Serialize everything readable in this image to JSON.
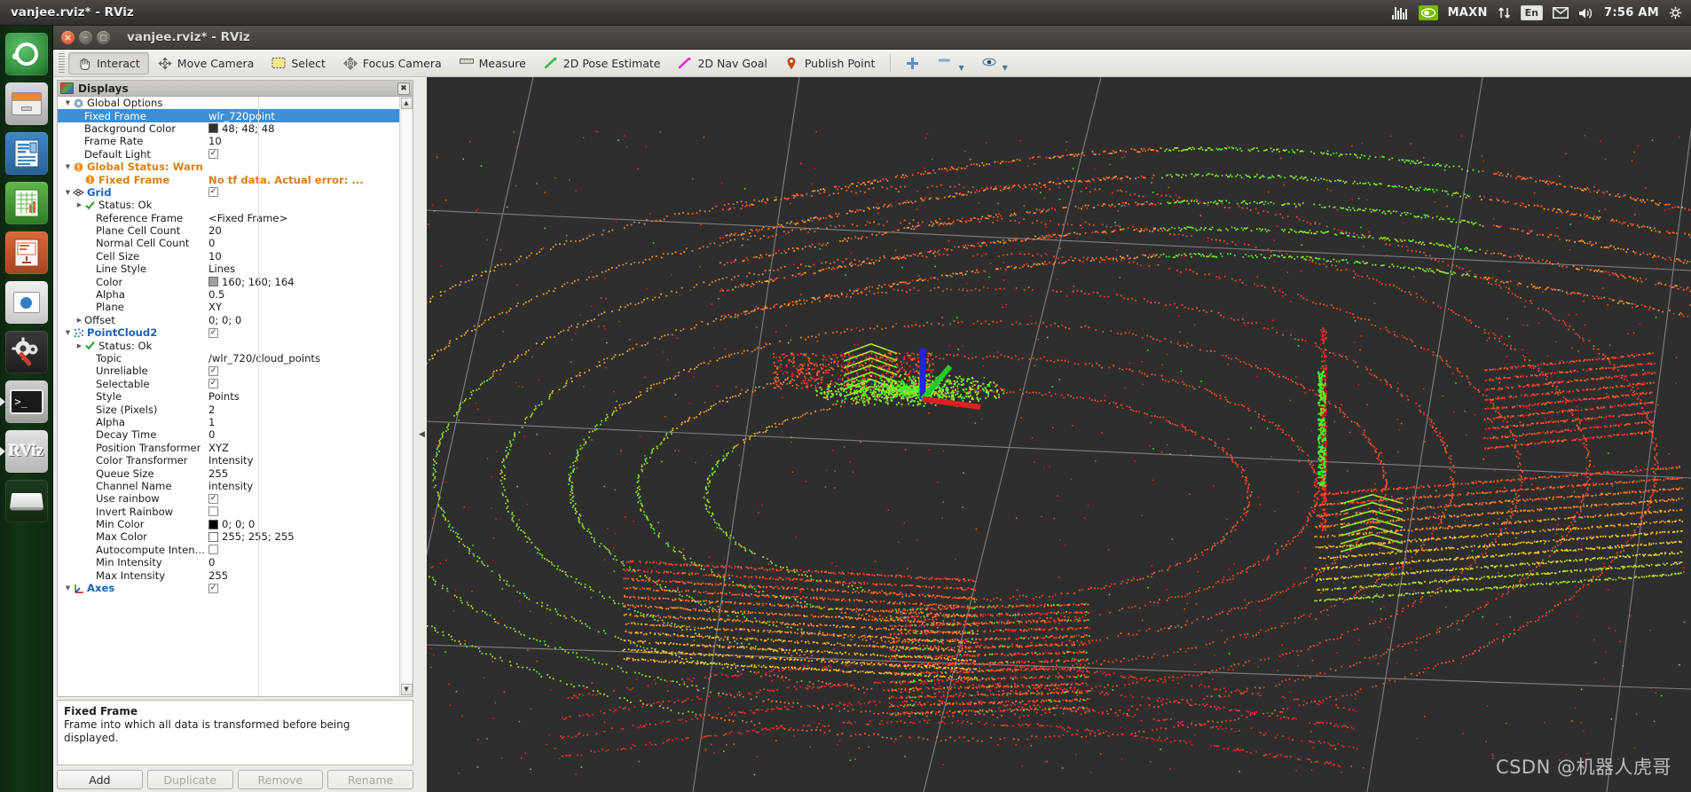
{
  "desktop": {
    "title": "vanjee.rviz* - RViz",
    "indicators": [
      {
        "name": "system-monitor-icon",
        "glyph": "ıll͡ıl",
        "type": "icon"
      },
      {
        "name": "nvidia-icon",
        "glyph": "",
        "type": "badge"
      },
      {
        "name": "maxn-indicator",
        "glyph": "MAXN",
        "type": "text"
      },
      {
        "name": "network-icon",
        "glyph": "↑↓",
        "type": "icon"
      },
      {
        "name": "keyboard-layout-indicator",
        "glyph": "En",
        "type": "kb"
      },
      {
        "name": "mail-icon",
        "glyph": "✉",
        "type": "icon"
      },
      {
        "name": "volume-icon",
        "glyph": "🔊",
        "type": "icon"
      },
      {
        "name": "clock",
        "glyph": "7:56 AM",
        "type": "text"
      },
      {
        "name": "session-menu-icon",
        "glyph": "⚙",
        "type": "icon"
      }
    ]
  },
  "launcher": {
    "items": [
      {
        "name": "ubuntu-dash-icon",
        "label": "Ubuntu Dash",
        "running": false
      },
      {
        "name": "files-icon",
        "label": "Files",
        "running": false
      },
      {
        "name": "libreoffice-writer-icon",
        "label": "LibreOffice Writer",
        "running": false
      },
      {
        "name": "libreoffice-calc-icon",
        "label": "LibreOffice Calc",
        "running": false
      },
      {
        "name": "libreoffice-impress-icon",
        "label": "LibreOffice Impress",
        "running": false
      },
      {
        "name": "ubuntu-software-icon",
        "label": "Ubuntu Software",
        "running": false
      },
      {
        "name": "system-settings-icon",
        "label": "System Settings",
        "running": false
      },
      {
        "name": "terminal-icon",
        "label": "Terminal",
        "running": true
      },
      {
        "name": "rviz-icon",
        "label": "RViz",
        "running": true
      },
      {
        "name": "disk-icon",
        "label": "Disk",
        "running": false
      }
    ]
  },
  "window": {
    "title": "vanjee.rviz* - RViz",
    "buttons": [
      "close",
      "minimize",
      "maximize"
    ]
  },
  "toolbar": {
    "items": [
      {
        "label": "Interact",
        "icon": "hand-cursor-icon",
        "active": true
      },
      {
        "label": "Move Camera",
        "icon": "move-camera-icon",
        "active": false
      },
      {
        "label": "Select",
        "icon": "select-rect-icon",
        "active": false
      },
      {
        "label": "Focus Camera",
        "icon": "focus-camera-icon",
        "active": false
      },
      {
        "label": "Measure",
        "icon": "measure-ruler-icon",
        "active": false
      },
      {
        "label": "2D Pose Estimate",
        "icon": "pose-estimate-arrow-icon",
        "active": false
      },
      {
        "label": "2D Nav Goal",
        "icon": "nav-goal-arrow-icon",
        "active": false
      },
      {
        "label": "Publish Point",
        "icon": "publish-point-pin-icon",
        "active": false
      }
    ],
    "tools": [
      {
        "name": "add-tool-button",
        "glyph": "+"
      },
      {
        "name": "remove-tool-button",
        "glyph": "–",
        "caret": true
      },
      {
        "name": "tool-properties-button",
        "glyph": "◉",
        "caret": true
      }
    ]
  },
  "displays_panel": {
    "title": "Displays",
    "close_label": "✖",
    "tree": [
      {
        "indent": 1,
        "arrow": "down",
        "icon": "gear-icon",
        "name": "Global Options",
        "value": "",
        "vtype": "none",
        "style": "plain",
        "selected": false
      },
      {
        "indent": 2,
        "arrow": "none",
        "icon": "none",
        "name": "Fixed Frame",
        "value": "wlr_720point",
        "vtype": "text",
        "style": "plain",
        "selected": true
      },
      {
        "indent": 2,
        "arrow": "none",
        "icon": "none",
        "name": "Background Color",
        "value": "48; 48; 48",
        "vtype": "color",
        "color": "#303030",
        "style": "plain",
        "selected": false
      },
      {
        "indent": 2,
        "arrow": "none",
        "icon": "none",
        "name": "Frame Rate",
        "value": "10",
        "vtype": "text",
        "style": "plain",
        "selected": false
      },
      {
        "indent": 2,
        "arrow": "none",
        "icon": "none",
        "name": "Default Light",
        "value": "",
        "vtype": "check",
        "checked": true,
        "style": "plain",
        "selected": false
      },
      {
        "indent": 1,
        "arrow": "down",
        "icon": "warning-icon",
        "name": "Global Status: Warn",
        "value": "",
        "vtype": "none",
        "style": "warn",
        "selected": false
      },
      {
        "indent": 2,
        "arrow": "none",
        "icon": "warning-icon",
        "name": "Fixed Frame",
        "value": "No tf data.  Actual error: ...",
        "vtype": "text",
        "style": "warn",
        "selected": false
      },
      {
        "indent": 1,
        "arrow": "down",
        "icon": "grid-icon",
        "name": "Grid",
        "value": "",
        "vtype": "check",
        "checked": true,
        "style": "cat",
        "selected": false
      },
      {
        "indent": 2,
        "arrow": "right",
        "icon": "ok-check-icon",
        "name": "Status: Ok",
        "value": "",
        "vtype": "none",
        "style": "plain",
        "selected": false
      },
      {
        "indent": 3,
        "arrow": "none",
        "icon": "none",
        "name": "Reference Frame",
        "value": "<Fixed Frame>",
        "vtype": "text",
        "style": "plain",
        "selected": false
      },
      {
        "indent": 3,
        "arrow": "none",
        "icon": "none",
        "name": "Plane Cell Count",
        "value": "20",
        "vtype": "text",
        "style": "plain",
        "selected": false
      },
      {
        "indent": 3,
        "arrow": "none",
        "icon": "none",
        "name": "Normal Cell Count",
        "value": "0",
        "vtype": "text",
        "style": "plain",
        "selected": false
      },
      {
        "indent": 3,
        "arrow": "none",
        "icon": "none",
        "name": "Cell Size",
        "value": "10",
        "vtype": "text",
        "style": "plain",
        "selected": false
      },
      {
        "indent": 3,
        "arrow": "none",
        "icon": "none",
        "name": "Line Style",
        "value": "Lines",
        "vtype": "text",
        "style": "plain",
        "selected": false
      },
      {
        "indent": 3,
        "arrow": "none",
        "icon": "none",
        "name": "Color",
        "value": "160; 160; 164",
        "vtype": "color",
        "color": "#a0a0a4",
        "style": "plain",
        "selected": false
      },
      {
        "indent": 3,
        "arrow": "none",
        "icon": "none",
        "name": "Alpha",
        "value": "0.5",
        "vtype": "text",
        "style": "plain",
        "selected": false
      },
      {
        "indent": 3,
        "arrow": "none",
        "icon": "none",
        "name": "Plane",
        "value": "XY",
        "vtype": "text",
        "style": "plain",
        "selected": false
      },
      {
        "indent": 2,
        "arrow": "right",
        "icon": "none",
        "name": "Offset",
        "value": "0; 0; 0",
        "vtype": "text",
        "style": "plain",
        "selected": false
      },
      {
        "indent": 1,
        "arrow": "down",
        "icon": "pointcloud-icon",
        "name": "PointCloud2",
        "value": "",
        "vtype": "check",
        "checked": true,
        "style": "cat",
        "selected": false
      },
      {
        "indent": 2,
        "arrow": "right",
        "icon": "ok-check-icon",
        "name": "Status: Ok",
        "value": "",
        "vtype": "none",
        "style": "plain",
        "selected": false
      },
      {
        "indent": 3,
        "arrow": "none",
        "icon": "none",
        "name": "Topic",
        "value": "/wlr_720/cloud_points",
        "vtype": "text",
        "style": "plain",
        "selected": false
      },
      {
        "indent": 3,
        "arrow": "none",
        "icon": "none",
        "name": "Unreliable",
        "value": "",
        "vtype": "check",
        "checked": true,
        "style": "plain",
        "selected": false
      },
      {
        "indent": 3,
        "arrow": "none",
        "icon": "none",
        "name": "Selectable",
        "value": "",
        "vtype": "check",
        "checked": true,
        "style": "plain",
        "selected": false
      },
      {
        "indent": 3,
        "arrow": "none",
        "icon": "none",
        "name": "Style",
        "value": "Points",
        "vtype": "text",
        "style": "plain",
        "selected": false
      },
      {
        "indent": 3,
        "arrow": "none",
        "icon": "none",
        "name": "Size (Pixels)",
        "value": "2",
        "vtype": "text",
        "style": "plain",
        "selected": false
      },
      {
        "indent": 3,
        "arrow": "none",
        "icon": "none",
        "name": "Alpha",
        "value": "1",
        "vtype": "text",
        "style": "plain",
        "selected": false
      },
      {
        "indent": 3,
        "arrow": "none",
        "icon": "none",
        "name": "Decay Time",
        "value": "0",
        "vtype": "text",
        "style": "plain",
        "selected": false
      },
      {
        "indent": 3,
        "arrow": "none",
        "icon": "none",
        "name": "Position Transformer",
        "value": "XYZ",
        "vtype": "text",
        "style": "plain",
        "selected": false
      },
      {
        "indent": 3,
        "arrow": "none",
        "icon": "none",
        "name": "Color Transformer",
        "value": "Intensity",
        "vtype": "text",
        "style": "plain",
        "selected": false
      },
      {
        "indent": 3,
        "arrow": "none",
        "icon": "none",
        "name": "Queue Size",
        "value": "255",
        "vtype": "text",
        "style": "plain",
        "selected": false
      },
      {
        "indent": 3,
        "arrow": "none",
        "icon": "none",
        "name": "Channel Name",
        "value": "intensity",
        "vtype": "text",
        "style": "plain",
        "selected": false
      },
      {
        "indent": 3,
        "arrow": "none",
        "icon": "none",
        "name": "Use rainbow",
        "value": "",
        "vtype": "check",
        "checked": true,
        "style": "plain",
        "selected": false
      },
      {
        "indent": 3,
        "arrow": "none",
        "icon": "none",
        "name": "Invert Rainbow",
        "value": "",
        "vtype": "check",
        "checked": false,
        "style": "plain",
        "selected": false
      },
      {
        "indent": 3,
        "arrow": "none",
        "icon": "none",
        "name": "Min Color",
        "value": "0; 0; 0",
        "vtype": "color",
        "color": "#000000",
        "style": "plain",
        "selected": false
      },
      {
        "indent": 3,
        "arrow": "none",
        "icon": "none",
        "name": "Max Color",
        "value": "255; 255; 255",
        "vtype": "color",
        "color": "#ffffff",
        "style": "plain",
        "selected": false
      },
      {
        "indent": 3,
        "arrow": "none",
        "icon": "none",
        "name": "Autocompute Intensi...",
        "value": "",
        "vtype": "check",
        "checked": false,
        "style": "plain",
        "selected": false
      },
      {
        "indent": 3,
        "arrow": "none",
        "icon": "none",
        "name": "Min Intensity",
        "value": "0",
        "vtype": "text",
        "style": "plain",
        "selected": false
      },
      {
        "indent": 3,
        "arrow": "none",
        "icon": "none",
        "name": "Max Intensity",
        "value": "255",
        "vtype": "text",
        "style": "plain",
        "selected": false
      },
      {
        "indent": 1,
        "arrow": "down",
        "icon": "axes-icon",
        "name": "Axes",
        "value": "",
        "vtype": "check",
        "checked": true,
        "style": "cat",
        "selected": false
      }
    ]
  },
  "help": {
    "title": "Fixed Frame",
    "body": "Frame into which all data is transformed before being displayed."
  },
  "buttons": [
    {
      "label": "Add",
      "enabled": true
    },
    {
      "label": "Duplicate",
      "enabled": false
    },
    {
      "label": "Remove",
      "enabled": false
    },
    {
      "label": "Rename",
      "enabled": false
    }
  ],
  "viewport": {
    "background_color": "#2e2e2e",
    "grid_color": "#a0a0a4",
    "axes": {
      "x_color": "#ff2020",
      "y_color": "#20d020",
      "z_color": "#2020ff"
    },
    "watermark": "CSDN @机器人虎哥",
    "collapse_handle": "◀"
  }
}
